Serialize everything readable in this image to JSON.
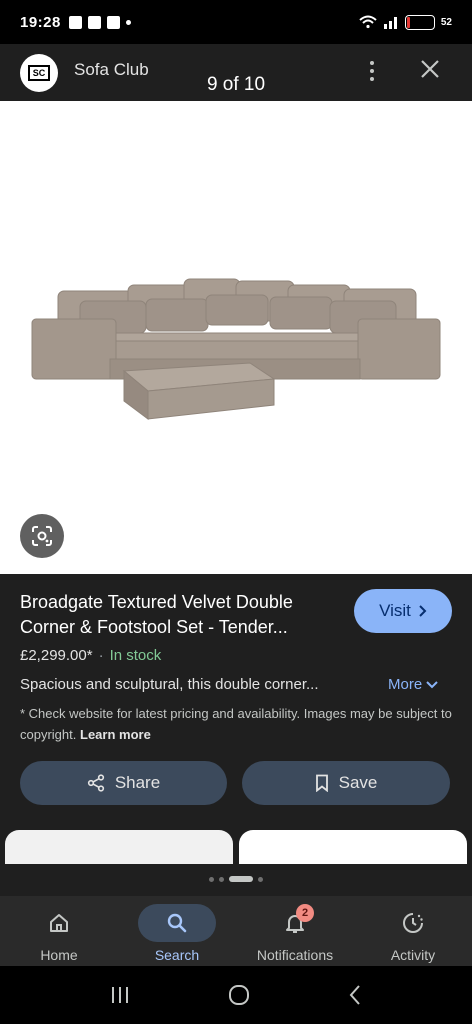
{
  "status_bar": {
    "time": "19:28",
    "battery": "52"
  },
  "header": {
    "site_name": "Sofa Club",
    "logo_text": "SC",
    "pager": "9 of 10"
  },
  "product": {
    "title": "Broadgate Textured Velvet Double Corner & Footstool Set - Tender...",
    "visit_label": "Visit",
    "price": "£2,299.00*",
    "stock": "In stock",
    "description": "Spacious and sculptural, this double corner...",
    "more_label": "More",
    "disclaimer": "* Check website for latest pricing and availability. Images may be subject to copyright.",
    "learn_more": "Learn more"
  },
  "actions": {
    "share_label": "Share",
    "save_label": "Save"
  },
  "bottom_nav": {
    "items": [
      {
        "label": "Home",
        "icon": "home-icon"
      },
      {
        "label": "Search",
        "icon": "search-icon"
      },
      {
        "label": "Notifications",
        "icon": "bell-icon",
        "badge": "2"
      },
      {
        "label": "Activity",
        "icon": "activity-icon"
      }
    ],
    "active": "Search"
  },
  "colors": {
    "background": "#1f1f1f",
    "accent": "#8ab4f8",
    "stock_green": "#81c995",
    "button_bg": "#3c4a5c",
    "sofa": "#a89c91"
  }
}
